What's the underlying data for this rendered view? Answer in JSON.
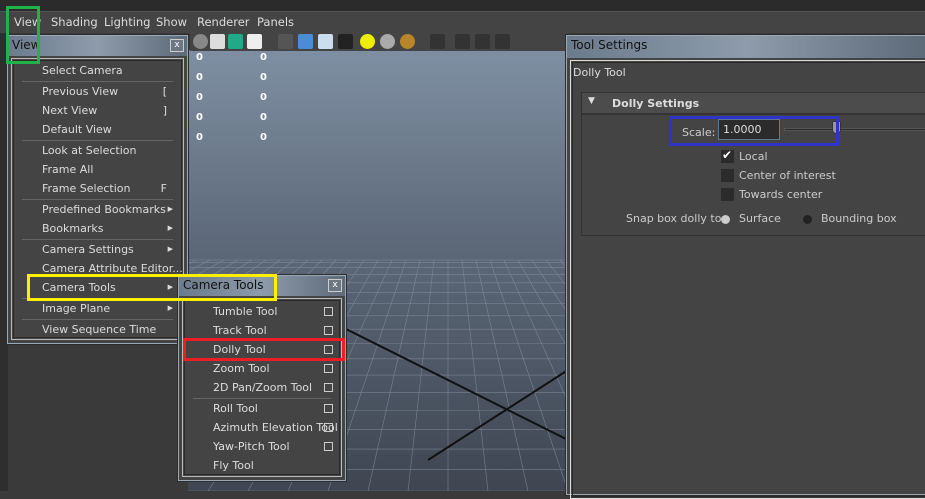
{
  "menubar": {
    "items": [
      "View",
      "Shading",
      "Lighting",
      "Show",
      "Renderer",
      "Panels"
    ]
  },
  "toolbar": {
    "icons": [
      "sphere-icon",
      "wireframe-icon",
      "bookmark-icon",
      "text-icon",
      "wire-cube-icon",
      "shaded-cube-icon",
      "wire-shaded-cube-icon",
      "checker-icon",
      "light-icon",
      "gray-sphere-icon",
      "gold-sphere-icon",
      "select-region-icon",
      "isolate-icon",
      "xray-icon",
      "share-icon"
    ]
  },
  "viewport": {
    "hud_values": [
      [
        "0",
        "0"
      ],
      [
        "0",
        "0"
      ],
      [
        "0",
        "0"
      ],
      [
        "0",
        "0"
      ],
      [
        "0",
        "0"
      ]
    ]
  },
  "view_menu": {
    "title": "View",
    "close": "x",
    "items": [
      {
        "label": "Select Camera"
      },
      {
        "label": "Previous View",
        "shortcut": "["
      },
      {
        "label": "Next View",
        "shortcut": "]"
      },
      {
        "label": "Default View"
      },
      {
        "label": "Look at Selection"
      },
      {
        "label": "Frame All"
      },
      {
        "label": "Frame Selection",
        "shortcut": "F"
      },
      {
        "label": "Predefined Bookmarks",
        "submenu": true
      },
      {
        "label": "Bookmarks",
        "submenu": true
      },
      {
        "label": "Camera Settings",
        "submenu": true
      },
      {
        "label": "Camera Attribute Editor..."
      },
      {
        "label": "Camera Tools",
        "submenu": true
      },
      {
        "label": "Image Plane",
        "submenu": true
      },
      {
        "label": "View Sequence Time"
      }
    ]
  },
  "camera_tools_menu": {
    "title": "Camera Tools",
    "close": "x",
    "items": [
      {
        "label": "Tumble Tool",
        "option": true
      },
      {
        "label": "Track Tool",
        "option": true
      },
      {
        "label": "Dolly Tool",
        "option": true
      },
      {
        "label": "Zoom Tool",
        "option": true
      },
      {
        "label": "2D Pan/Zoom Tool",
        "option": true
      },
      {
        "label": "Roll Tool",
        "option": true
      },
      {
        "label": "Azimuth Elevation Tool",
        "option": true
      },
      {
        "label": "Yaw-Pitch Tool",
        "option": true
      },
      {
        "label": "Fly Tool",
        "option": false
      }
    ]
  },
  "tool_settings": {
    "title": "Tool Settings",
    "tool_name": "Dolly Tool",
    "section": "Dolly Settings",
    "scale_label": "Scale:",
    "scale_value": "1.0000",
    "scale_slider_fraction": 0.6,
    "local_label": "Local",
    "local_checked": true,
    "coi_label": "Center of interest",
    "coi_checked": false,
    "towards_label": "Towards center",
    "towards_checked": false,
    "snap_label": "Snap box dolly to:",
    "snap_options": [
      "Surface",
      "Bounding box"
    ],
    "snap_selected": "Surface"
  },
  "highlights": {
    "green": "#1fb34a",
    "yellow": "#ffee00",
    "red": "#ee1c24",
    "blue": "#3033c8"
  }
}
